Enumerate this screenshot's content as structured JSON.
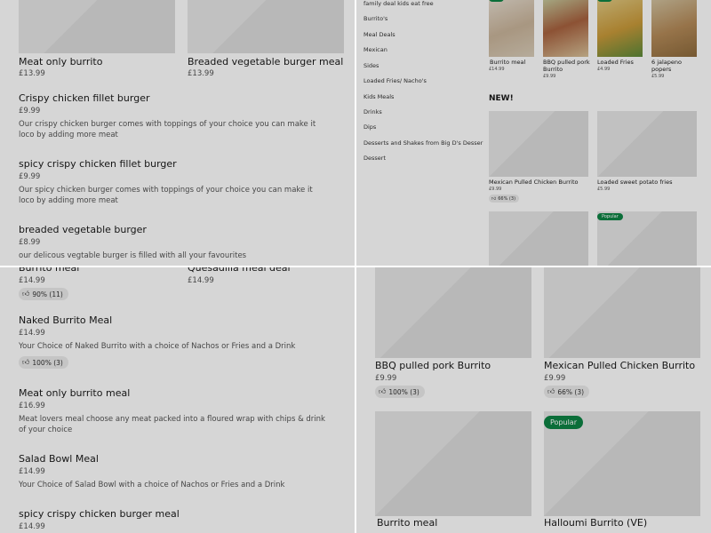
{
  "q1": {
    "cards": [
      {
        "title": "Meat only burrito",
        "price": "£13.99"
      },
      {
        "title": "Breaded vegetable burger meal",
        "price": "£13.99"
      }
    ],
    "items": [
      {
        "title": "Crispy chicken fillet burger",
        "price": "£9.99",
        "desc": "Our crispy chicken burger comes with toppings of your choice you can make it loco by adding more meat"
      },
      {
        "title": "spicy crispy chicken fillet burger",
        "price": "£9.99",
        "desc": "Our spicy chicken burger comes with toppings of your choice you can make it loco by adding more meat"
      },
      {
        "title": "breaded vegetable burger",
        "price": "£8.99",
        "desc": "our delicous vegtable burger is filled with all your favourites"
      }
    ]
  },
  "q2": {
    "categories": [
      "family deal kids eat free",
      "Burrito's",
      "Meal Deals",
      "Mexican",
      "Sides",
      "Loaded Fries/ Nacho's",
      "Kids Meals",
      "Drinks",
      "Dips",
      "Desserts and Shakes from Big D's Desser",
      "Dessert"
    ],
    "featured": [
      {
        "title": "Burrito meal",
        "price": "£14.99"
      },
      {
        "title": "BBQ pulled pork Burrito",
        "price": "£9.99"
      },
      {
        "title": "Loaded Fries",
        "price": "£4.99"
      },
      {
        "title": "6 jalapeno popers",
        "price": "£5.99"
      }
    ],
    "new_heading": "NEW!",
    "new_items": [
      {
        "title": "Mexican Pulled Chicken Burrito",
        "price": "£9.99",
        "rating": "66% (3)"
      },
      {
        "title": "Loaded  sweet potato fries",
        "price": "£5.99"
      }
    ],
    "popular_badge": "Popular"
  },
  "q3": {
    "cards": [
      {
        "title": "Burrito meal",
        "price": "£14.99",
        "rating": "90% (11)"
      },
      {
        "title": "Quesadilla meal deal",
        "price": "£14.99"
      }
    ],
    "items": [
      {
        "title": "Naked Burrito Meal",
        "price": "£14.99",
        "desc": "Your Choice of Naked Burrito with a choice of Nachos or Fries and a Drink",
        "rating": "100% (3)"
      },
      {
        "title": "Meat only burrito meal",
        "price": "£16.99",
        "desc": "Meat lovers meal choose any meat packed into a floured wrap with chips & drink of your choice"
      },
      {
        "title": "Salad Bowl Meal",
        "price": "£14.99",
        "desc": "Your Choice of Salad Bowl with a choice of Nachos or Fries and a Drink"
      },
      {
        "title": "spicy crispy chicken burger meal",
        "price": "£14.99"
      }
    ]
  },
  "q4": {
    "cards": [
      {
        "title": "BBQ pulled pork Burrito",
        "price": "£9.99",
        "rating": "100% (3)"
      },
      {
        "title": "Mexican Pulled Chicken Burrito",
        "price": "£9.99",
        "rating": "66% (3)"
      },
      {
        "title": "Burrito meal"
      },
      {
        "title": "Halloumi Burrito (VE)"
      }
    ],
    "popular_badge": "Popular"
  },
  "icons": {
    "thumb": "thumbs-up-icon"
  },
  "colors": {
    "accent": "#0e8345",
    "overlay": "rgba(0,0,0,0.16)"
  }
}
